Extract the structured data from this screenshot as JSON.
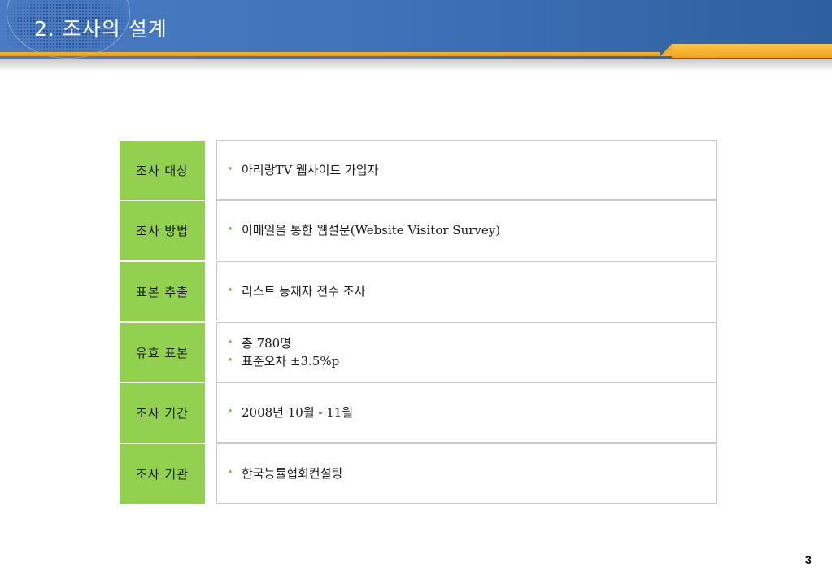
{
  "header": {
    "title": "2. 조사의 설계"
  },
  "rows": [
    {
      "label": "조사 대상",
      "items": [
        "아리랑TV 웹사이트 가입자"
      ]
    },
    {
      "label": "조사 방법",
      "items": [
        "이메일을 통한 웹설문(Website Visitor Survey)"
      ]
    },
    {
      "label": "표본 추출",
      "items": [
        "리스트 등재자 전수 조사"
      ]
    },
    {
      "label": "유효 표본",
      "items": [
        "총 780명",
        "표준오차 ±3.5%p"
      ]
    },
    {
      "label": "조사 기간",
      "items": [
        "2008년 10월 - 11월"
      ]
    },
    {
      "label": "조사 기관",
      "items": [
        "한국능률협회컨설팅"
      ]
    }
  ],
  "bullet_glyph": "•",
  "colors": {
    "header_blue": "#3f72b9",
    "gold": "#f0a21f",
    "label_green": "#92d050",
    "bullet_green": "#7fc24a"
  },
  "footer": {
    "page_number": "3"
  }
}
